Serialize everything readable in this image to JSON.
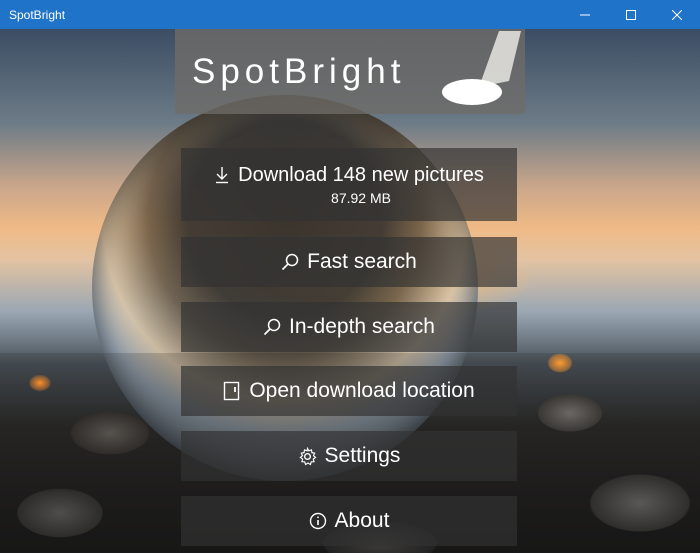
{
  "window": {
    "title": "SpotBright",
    "controls": {
      "minimize": "minimize-icon",
      "maximize": "maximize-icon",
      "close": "close-icon"
    }
  },
  "logo": {
    "text": "SpotBright",
    "icon": "spotlight-icon"
  },
  "menu": {
    "download": {
      "label": "Download 148 new pictures",
      "size": "87.92 MB",
      "icon": "download-icon"
    },
    "fast_search": {
      "label": "Fast search",
      "icon": "search-icon"
    },
    "indepth_search": {
      "label": "In-depth search",
      "icon": "search-icon"
    },
    "open_location": {
      "label": "Open download location",
      "icon": "folder-open-icon"
    },
    "settings": {
      "label": "Settings",
      "icon": "gear-icon"
    },
    "about": {
      "label": "About",
      "icon": "info-icon"
    }
  },
  "colors": {
    "titlebar": "#1f73c8",
    "button_bg": "rgba(50,50,50,0.68)",
    "logo_bg": "rgba(110,108,104,0.78)"
  }
}
